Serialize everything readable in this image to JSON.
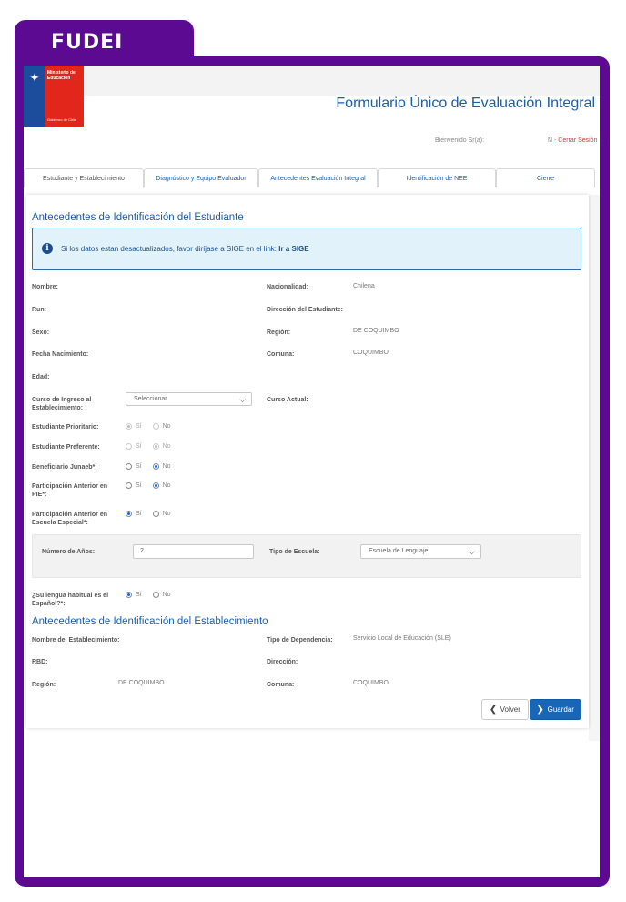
{
  "brand": {
    "badge": "FUDEI"
  },
  "logo": {
    "line1": "Ministerio de Educación",
    "line2": "Gobierno de Chile"
  },
  "header": {
    "form_title": "Formulario Único de Evaluación Integral",
    "welcome": "Bienvenido Sr(a):",
    "user_prefix": "N - ",
    "logout": "Cerrar Sesión"
  },
  "tabs": [
    {
      "label": "Estudiante y Establecimiento",
      "active": true
    },
    {
      "label": "Diagnóstico y Equipo Evaluador",
      "active": false
    },
    {
      "label": "Antecedentes Evaluación Integral",
      "active": false
    },
    {
      "label": "Identificación de NEE",
      "active": false
    },
    {
      "label": "Cierre",
      "active": false
    }
  ],
  "student_section": {
    "title": "Antecedentes de Identificación del Estudiante",
    "alert_text": "Si los datos estan desactualizados, favor diríjase a SIGE en el link: ",
    "alert_link": "Ir a SIGE",
    "labels": {
      "nombre": "Nombre:",
      "run": "Run:",
      "sexo": "Sexo:",
      "fecha_nacimiento": "Fecha Nacimiento:",
      "edad": "Edad:",
      "curso_ingreso": "Curso de Ingreso al Establecimiento:",
      "nacionalidad": "Nacionalidad:",
      "direccion": "Dirección del Estudiante:",
      "region": "Región:",
      "comuna": "Comuna:",
      "curso_actual": "Curso Actual:",
      "prioritario": "Estudiante Prioritario:",
      "preferente": "Estudiante Preferente:",
      "junaeb": "Beneficiario Junaeb*:",
      "pie": "Participación Anterior en PIE*:",
      "escuela_especial": "Participación Anterior en Escuela Especial*:",
      "numero_anios": "Número de Años:",
      "tipo_escuela": "Tipo de Escuela:",
      "lengua": "¿Su lengua habitual es el Español?*:"
    },
    "values": {
      "nacionalidad": "Chilena",
      "region": "DE COQUIMBO",
      "comuna": "COQUIMBO",
      "curso_ingreso": "Seleccionar",
      "numero_anios": "2",
      "tipo_escuela": "Escuela de Lenguaje"
    },
    "radio_si": "Sí",
    "radio_no": "No",
    "radios": {
      "prioritario": "si",
      "preferente": "no",
      "junaeb": "no",
      "pie": "no",
      "escuela_especial": "si",
      "lengua": "si"
    }
  },
  "school_section": {
    "title": "Antecedentes de Identificación del Establecimiento",
    "labels": {
      "nombre": "Nombre del Establecimiento:",
      "rbd": "RBD:",
      "region": "Región:",
      "tipo_dependencia": "Tipo de Dependencia:",
      "direccion": "Dirección:",
      "comuna": "Comuna:"
    },
    "values": {
      "tipo_dependencia": "Servicio Local de Educación (SLE)",
      "region": "DE COQUIMBO",
      "comuna": "COQUIMBO"
    }
  },
  "buttons": {
    "back": "Volver",
    "save": "Guardar"
  },
  "colors": {
    "frame": "#5b0a91",
    "primary": "#1766b8",
    "title_blue": "#1b5ea9",
    "alert_bg": "#e2f2fa"
  }
}
